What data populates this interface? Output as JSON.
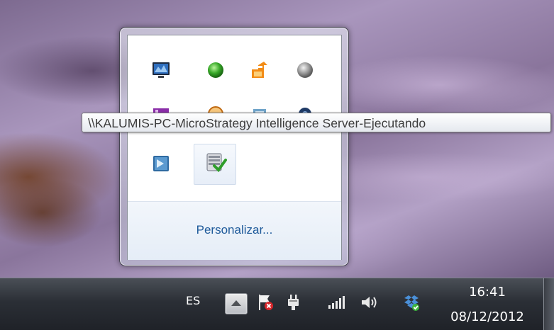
{
  "taskbar": {
    "language": "ES",
    "clock": {
      "time": "16:41",
      "date": "08/12/2012"
    },
    "tray_icons": [
      "show-hidden-icons-button",
      "action-center-flag-error-icon",
      "power-plug-icon",
      "network-signal-icon",
      "volume-icon",
      "dropbox-icon"
    ]
  },
  "popup": {
    "customize_link": "Personalizar...",
    "icons": [
      "monitor-app-icon",
      "green-status-icon",
      "orange-update-icon",
      "gray-status-icon",
      "onenote-icon",
      "orange-clock-icon",
      "app-window-icon",
      "blue-gear-icon",
      "terminal-app-icon",
      "microstrategy-server-icon"
    ]
  },
  "tooltip": {
    "text": "\\\\KALUMIS-PC-MicroStrategy Intelligence Server-Ejecutando"
  },
  "colors": {
    "link": "#1e5a9a",
    "taskbar": "#2b2f36",
    "popup_footer": "#e9f0f8"
  }
}
